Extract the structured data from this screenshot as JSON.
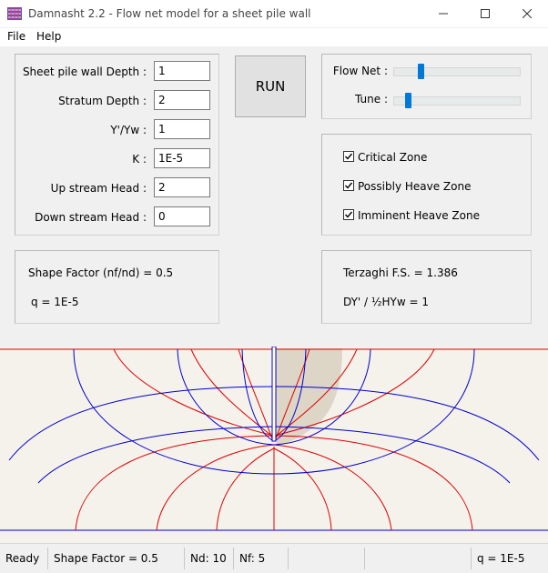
{
  "window": {
    "title": "Damnasht 2.2  -  Flow net model for a sheet pile wall"
  },
  "menu": {
    "file": "File",
    "help": "Help"
  },
  "inputs": {
    "sheet_pile_depth": {
      "label": "Sheet pile wall Depth :",
      "value": "1"
    },
    "stratum_depth": {
      "label": "Stratum Depth :",
      "value": "2"
    },
    "gamma_ratio": {
      "label": "Y'/Yw :",
      "value": "1"
    },
    "k": {
      "label": "K :",
      "value": "1E-5"
    },
    "upstream_head": {
      "label": "Up stream Head :",
      "value": "2"
    },
    "downstream_head": {
      "label": "Down stream Head :",
      "value": "0"
    }
  },
  "run_button": "RUN",
  "sliders": {
    "flow_net": {
      "label": "Flow Net :",
      "value": 0.2
    },
    "tune": {
      "label": "Tune :",
      "value": 0.1
    }
  },
  "checkboxes": {
    "critical_zone": {
      "label": "Critical Zone",
      "checked": true
    },
    "possibly_heave_zone": {
      "label": "Possibly Heave Zone",
      "checked": true
    },
    "imminent_heave_zone": {
      "label": "Imminent Heave Zone",
      "checked": true
    }
  },
  "results": {
    "shape_factor": "Shape Factor (nf/nd) = 0.5",
    "q": "q = 1E-5",
    "terzaghi": "Terzaghi F.S. = 1.386",
    "dy_ratio": "DY' / ½HYw = 1"
  },
  "status": {
    "ready": "Ready",
    "shape_factor": "Shape Factor = 0.5",
    "nd": "Nd: 10",
    "nf": "Nf: 5",
    "q": "q = 1E-5"
  },
  "colors": {
    "flow_line": "#0000cc",
    "equipotential": "#dd0000",
    "heave_zone": "#ddd5c6",
    "canvas_bg": "#f5f2ec",
    "accent": "#0078d7"
  }
}
